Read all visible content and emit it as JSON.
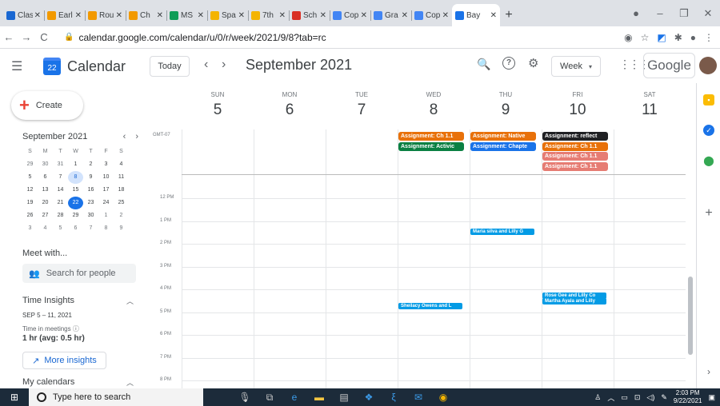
{
  "tabs": [
    {
      "label": "Clas",
      "color": "#1967d2"
    },
    {
      "label": "Earl",
      "color": "#f29900"
    },
    {
      "label": "Rou",
      "color": "#f29900"
    },
    {
      "label": "Ch",
      "color": "#f29900"
    },
    {
      "label": "MS",
      "color": "#0f9d58"
    },
    {
      "label": "Spa",
      "color": "#f4b400"
    },
    {
      "label": "7th",
      "color": "#f4b400"
    },
    {
      "label": "Sch",
      "color": "#d93025"
    },
    {
      "label": "Cop",
      "color": "#4285f4"
    },
    {
      "label": "Gra",
      "color": "#4285f4"
    },
    {
      "label": "Cop",
      "color": "#4285f4"
    },
    {
      "label": "Bay",
      "color": "#1a73e8",
      "active": true
    }
  ],
  "address": {
    "url": "calendar.google.com/calendar/u/0/r/week/2021/9/8?tab=rc"
  },
  "header": {
    "app_name": "Calendar",
    "cal_icon_num": "22",
    "today_label": "Today",
    "date_title": "September 2021",
    "view_label": "Week",
    "google_label": "Google"
  },
  "sidebar": {
    "create_label": "Create",
    "mini_month": "September 2021",
    "weekdays": [
      "S",
      "M",
      "T",
      "W",
      "T",
      "F",
      "S"
    ],
    "days": [
      "29",
      "30",
      "31",
      "1",
      "2",
      "3",
      "4",
      "5",
      "6",
      "7",
      "8",
      "9",
      "10",
      "11",
      "12",
      "13",
      "14",
      "15",
      "16",
      "17",
      "18",
      "19",
      "20",
      "21",
      "22",
      "23",
      "24",
      "25",
      "26",
      "27",
      "28",
      "29",
      "30",
      "1",
      "2",
      "3",
      "4",
      "5",
      "6",
      "7",
      "8",
      "9"
    ],
    "meet_with": "Meet with...",
    "search_people": "Search for people",
    "time_insights": "Time Insights",
    "range": "SEP 5 – 11, 2021",
    "time_in_meetings": "Time in meetings",
    "hours": "1 hr (avg: 0.5 hr)",
    "more_insights": "More insights",
    "my_calendars": "My calendars"
  },
  "days": [
    {
      "name": "SUN",
      "num": "5"
    },
    {
      "name": "MON",
      "num": "6"
    },
    {
      "name": "TUE",
      "num": "7"
    },
    {
      "name": "WED",
      "num": "8"
    },
    {
      "name": "THU",
      "num": "9"
    },
    {
      "name": "FRI",
      "num": "10"
    },
    {
      "name": "SAT",
      "num": "11"
    }
  ],
  "timezone": "GMT-07",
  "time_labels": [
    "12 PM",
    "1 PM",
    "2 PM",
    "3 PM",
    "4 PM",
    "5 PM",
    "6 PM",
    "7 PM",
    "8 PM"
  ],
  "events": [
    {
      "day": 3,
      "row": 0,
      "title": "Assignment: Ch 1.1",
      "color": "#e8710a"
    },
    {
      "day": 3,
      "row": 1,
      "title": "Assignment: Activic",
      "color": "#0b8043"
    },
    {
      "day": 4,
      "row": 0,
      "title": "Assignment: Native",
      "color": "#e8710a"
    },
    {
      "day": 4,
      "row": 1,
      "title": "Assignment: Chapte",
      "color": "#1a73e8"
    },
    {
      "day": 5,
      "row": 0,
      "title": "Assignment: reflect",
      "color": "#202124"
    },
    {
      "day": 5,
      "row": 1,
      "title": "Assignment: Ch 1.1",
      "color": "#e8710a"
    },
    {
      "day": 5,
      "row": 2,
      "title": "Assignment: Ch 1.1",
      "color": "#e67c73"
    },
    {
      "day": 5,
      "row": 3,
      "title": "Assignment: Ch 1.1",
      "color": "#e67c73"
    },
    {
      "day": 4,
      "time": "Maria silva and Lilly G",
      "slot": 1.35,
      "color": "#039be5"
    },
    {
      "day": 5,
      "time": "Rose Gee and Lilly Co",
      "slot": 4.15,
      "color": "#039be5"
    },
    {
      "day": 5,
      "time": "Martha Ayala and Lilly",
      "slot": 4.4,
      "color": "#039be5"
    },
    {
      "day": 3,
      "time": "Sheilacy Owens and L",
      "slot": 4.6,
      "color": "#039be5"
    }
  ],
  "taskbar": {
    "search_placeholder": "Type here to search",
    "time": "2:03 PM",
    "date": "9/22/2021"
  }
}
